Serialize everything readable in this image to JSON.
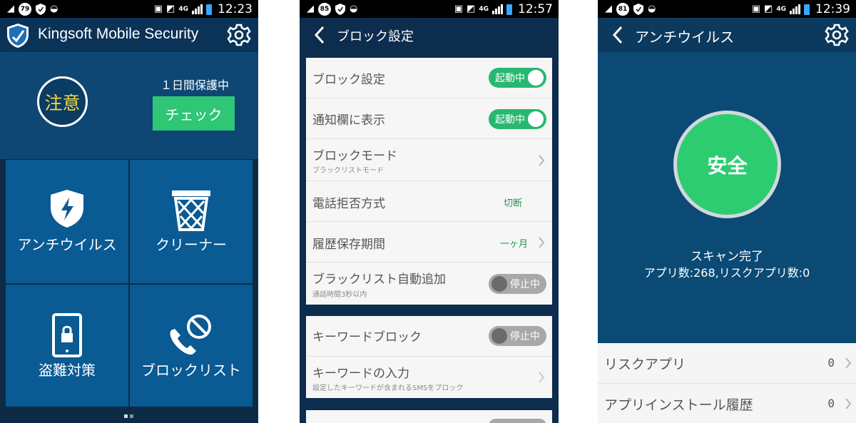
{
  "status": {
    "screen1": {
      "battery_pct": "79",
      "network": "4G",
      "time": "12:23"
    },
    "screen2": {
      "battery_pct": "85",
      "network": "4G",
      "time": "12:57"
    },
    "screen3": {
      "battery_pct": "81",
      "network": "4G",
      "time": "12:39"
    }
  },
  "home": {
    "app_title": "Kingsoft Mobile Security",
    "status_label": "注意",
    "protection_text": "１日間保護中",
    "check_button": "チェック",
    "tiles": [
      {
        "label": "アンチウイルス",
        "icon": "shield-bolt-icon"
      },
      {
        "label": "クリーナー",
        "icon": "trash-icon"
      },
      {
        "label": "盗難対策",
        "icon": "phone-lock-icon"
      },
      {
        "label": "ブロックリスト",
        "icon": "phone-block-icon"
      }
    ]
  },
  "block_settings": {
    "title": "ブロック設定",
    "rows": [
      {
        "title": "ブロック設定",
        "toggle": "起動中"
      },
      {
        "title": "通知欄に表示",
        "toggle": "起動中"
      },
      {
        "title": "ブロックモード",
        "subtitle": "ブラックリストモード"
      },
      {
        "title": "電話拒否方式",
        "value": "切断"
      },
      {
        "title": "履歴保存期間",
        "value": "一ヶ月"
      },
      {
        "title": "ブラックリスト自動追加",
        "subtitle": "通話時間3秒以内",
        "toggle": "停止中"
      },
      {
        "title": "キーワードブロック",
        "toggle": "停止中"
      },
      {
        "title": "キーワードの入力",
        "subtitle": "設定したキーワードが含まれるSMSをブロック"
      }
    ]
  },
  "antivirus": {
    "title": "アンチウイルス",
    "status": "安全",
    "scan_done": "スキャン完了",
    "scan_summary": "アプリ数:268,リスクアプリ数:0",
    "list": [
      {
        "title": "リスクアプリ",
        "count": "0"
      },
      {
        "title": "アプリインストール履歴",
        "count": "0"
      }
    ]
  },
  "colors": {
    "accent_green": "#2fc676",
    "caution_yellow": "#f5d742",
    "tile_blue": "#0a5a94",
    "header_navy": "#0b3358"
  }
}
